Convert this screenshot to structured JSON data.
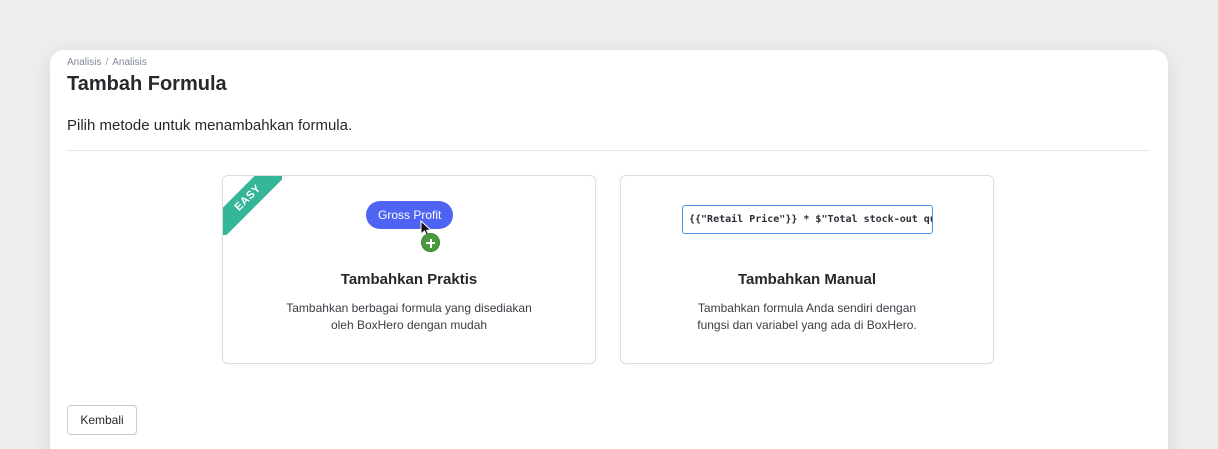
{
  "breadcrumb": {
    "items": [
      "Analisis",
      "Analisis"
    ],
    "separator": "/"
  },
  "page": {
    "title": "Tambah Formula",
    "instruction": "Pilih metode untuk menambahkan formula."
  },
  "cards": {
    "practical": {
      "badge": "EASY",
      "preview_pill": "Gross Profit",
      "title": "Tambahkan Praktis",
      "desc_line1": "Tambahkan berbagai formula yang disediakan",
      "desc_line2": "oleh BoxHero dengan mudah"
    },
    "manual": {
      "preview_formula": "{{\"Retail Price\"}} * $\"Total stock-out quantity\"",
      "title": "Tambahkan Manual",
      "desc_line1": "Tambahkan formula Anda sendiri dengan",
      "desc_line2": "fungsi dan variabel yang ada di BoxHero."
    }
  },
  "footer": {
    "back_label": "Kembali"
  },
  "colors": {
    "accent_blue": "#4f63f2",
    "badge_green": "#35b59a",
    "plus_green": "#4b9a3d",
    "input_border": "#4a90e2"
  },
  "icons": {
    "cursor": "mouse-pointer-icon",
    "plus": "plus-circle-icon"
  }
}
